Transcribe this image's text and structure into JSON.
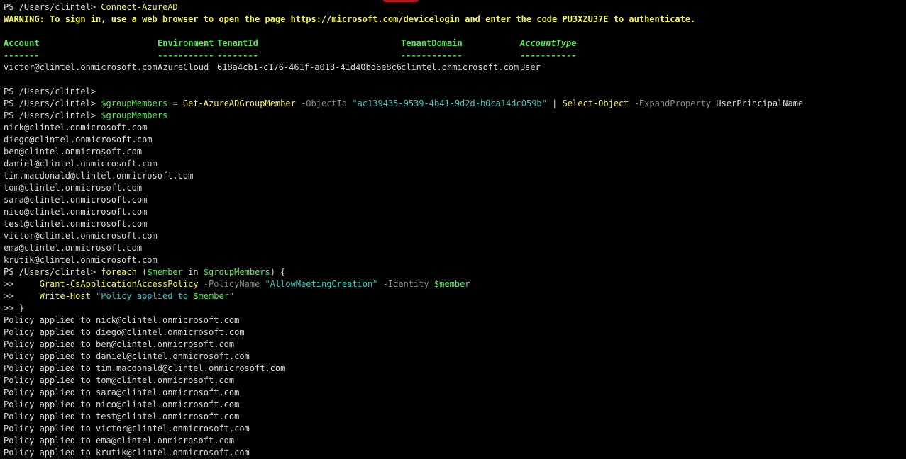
{
  "terminal": {
    "prompt": "PS /Users/clintel>",
    "cont_prompt": ">>",
    "connect_cmd": "Connect-AzureAD",
    "warning": "WARNING: To sign in, use a web browser to open the page https://microsoft.com/devicelogin and enter the code PU3XZU37E to authenticate.",
    "table": {
      "headers": [
        "Account",
        "Environment",
        "TenantId",
        "TenantDomain",
        "AccountType"
      ],
      "underlines": [
        "-------",
        "-----------",
        "--------",
        "------------",
        "-----------"
      ],
      "values": [
        "victor@clintel.onmicrosoft.com",
        "AzureCloud",
        "618a4cb1-c176-461f-a013-41d40bd6e8c6",
        "clintel.onmicrosoft.com",
        "User"
      ]
    },
    "group_cmd": {
      "var": "$groupMembers",
      "eq": " = ",
      "cmd": "Get-AzureADGroupMember",
      "param1": "-ObjectId",
      "str1": "\"ac139435-9539-4b41-9d2d-b0ca14dc059b\"",
      "pipe": " | ",
      "cmd2": "Select-Object",
      "param2": "-ExpandProperty",
      "arg2": "UserPrincipalName"
    },
    "echo_var": "$groupMembers",
    "members": [
      "nick@clintel.onmicrosoft.com",
      "diego@clintel.onmicrosoft.com",
      "ben@clintel.onmicrosoft.com",
      "daniel@clintel.onmicrosoft.com",
      "tim.macdonald@clintel.onmicrosoft.com",
      "tom@clintel.onmicrosoft.com",
      "sara@clintel.onmicrosoft.com",
      "nico@clintel.onmicrosoft.com",
      "test@clintel.onmicrosoft.com",
      "victor@clintel.onmicrosoft.com",
      "ema@clintel.onmicrosoft.com",
      "krutik@clintel.onmicrosoft.com"
    ],
    "foreach": {
      "kw": "foreach",
      "open": " (",
      "member": "$member",
      "in": " in ",
      "coll": "$groupMembers",
      "close": ") {"
    },
    "grant": {
      "cmd": "Grant-CsApplicationAccessPolicy",
      "param1": "-PolicyName",
      "str1": "\"AllowMeetingCreation\"",
      "param2": "-Identity",
      "var": "$member"
    },
    "write": {
      "cmd": "Write-Host",
      "str_pre": "\"Policy applied to ",
      "var": "$member",
      "str_post": "\""
    },
    "close_brace": ">> }",
    "policy_prefix": "Policy applied to ",
    "policy_results": [
      "nick@clintel.onmicrosoft.com",
      "diego@clintel.onmicrosoft.com",
      "ben@clintel.onmicrosoft.com",
      "daniel@clintel.onmicrosoft.com",
      "tim.macdonald@clintel.onmicrosoft.com",
      "tom@clintel.onmicrosoft.com",
      "sara@clintel.onmicrosoft.com",
      "nico@clintel.onmicrosoft.com",
      "test@clintel.onmicrosoft.com",
      "victor@clintel.onmicrosoft.com",
      "ema@clintel.onmicrosoft.com",
      "krutik@clintel.onmicrosoft.com"
    ]
  },
  "colors": {
    "background": "#000000",
    "text": "#d8d8d8",
    "command": "#f4f25c",
    "variable": "#5fe65f",
    "parameter": "#8a8a8a",
    "string": "#3fc6c6"
  }
}
